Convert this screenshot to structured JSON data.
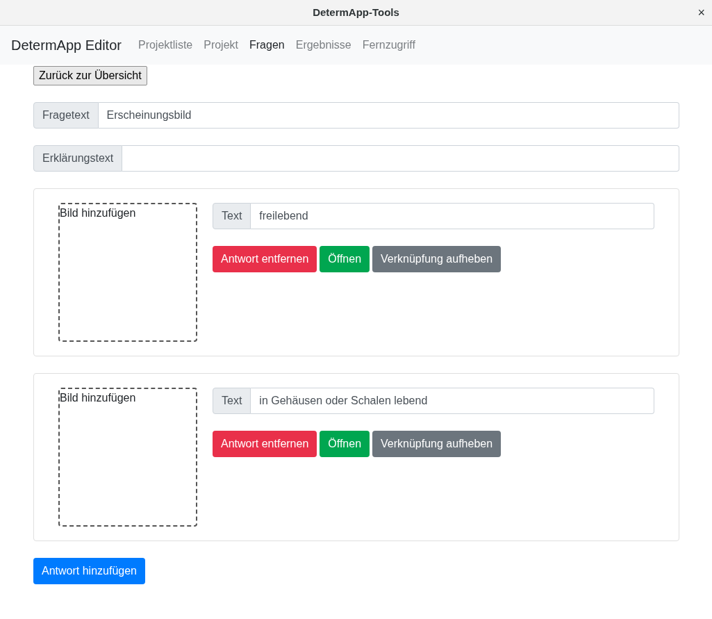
{
  "window": {
    "title": "DetermApp-Tools",
    "close": "×"
  },
  "navbar": {
    "brand": "DetermApp Editor",
    "items": [
      {
        "label": "Projektliste",
        "selected": false
      },
      {
        "label": "Projekt",
        "selected": false
      },
      {
        "label": "Fragen",
        "selected": true
      },
      {
        "label": "Ergebnisse",
        "selected": false
      },
      {
        "label": "Fernzugriff",
        "selected": false
      }
    ]
  },
  "back_button": "Zurück zur Übersicht",
  "fields": [
    {
      "label": "Fragetext",
      "value": "Erscheinungsbild"
    },
    {
      "label": "Erklärungstext"
    }
  ],
  "answers": [
    {
      "image_label": "Bild hinzufügen",
      "text_label": "Text",
      "text_value": "freilebend",
      "buttons": [
        "Antwort entfernen",
        "Öffnen",
        "Verknüpfung aufheben"
      ]
    },
    {
      "image_label": "Bild hinzufügen",
      "text_label": "Text",
      "text_value": "in Gehäusen oder Schalen lebend",
      "buttons": [
        "Antwort entfernen",
        "Öffnen",
        "Verknüpfung aufheben"
      ]
    }
  ],
  "add_button": "Antwort hinzufügen"
}
